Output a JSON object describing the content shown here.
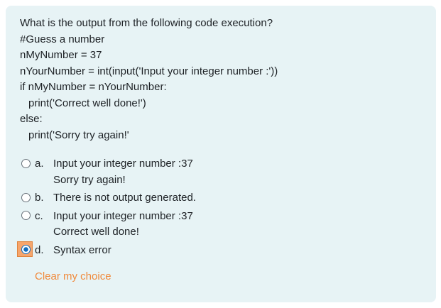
{
  "question": {
    "lines": [
      "What is the output from the following code execution?",
      "#Guess a number",
      "nMyNumber = 37",
      "nYourNumber = int(input('Input your integer number :'))",
      "if nMyNumber = nYourNumber:",
      "print('Correct well done!')",
      "else:",
      "print('Sorry try again!'"
    ]
  },
  "options": [
    {
      "letter": "a.",
      "lines": [
        "Input your integer number :37",
        "Sorry try again!"
      ],
      "selected": false
    },
    {
      "letter": "b.",
      "lines": [
        "There is not output generated."
      ],
      "selected": false
    },
    {
      "letter": "c.",
      "lines": [
        "Input your integer number :37",
        "Correct well done!"
      ],
      "selected": false
    },
    {
      "letter": "d.",
      "lines": [
        "Syntax error"
      ],
      "selected": true
    }
  ],
  "clear_choice_label": "Clear my choice",
  "colors": {
    "card_background": "#e7f3f5",
    "selected_radio": "#0f6cbf",
    "focus_highlight": "#f6a56c",
    "link": "#f08a3c"
  }
}
